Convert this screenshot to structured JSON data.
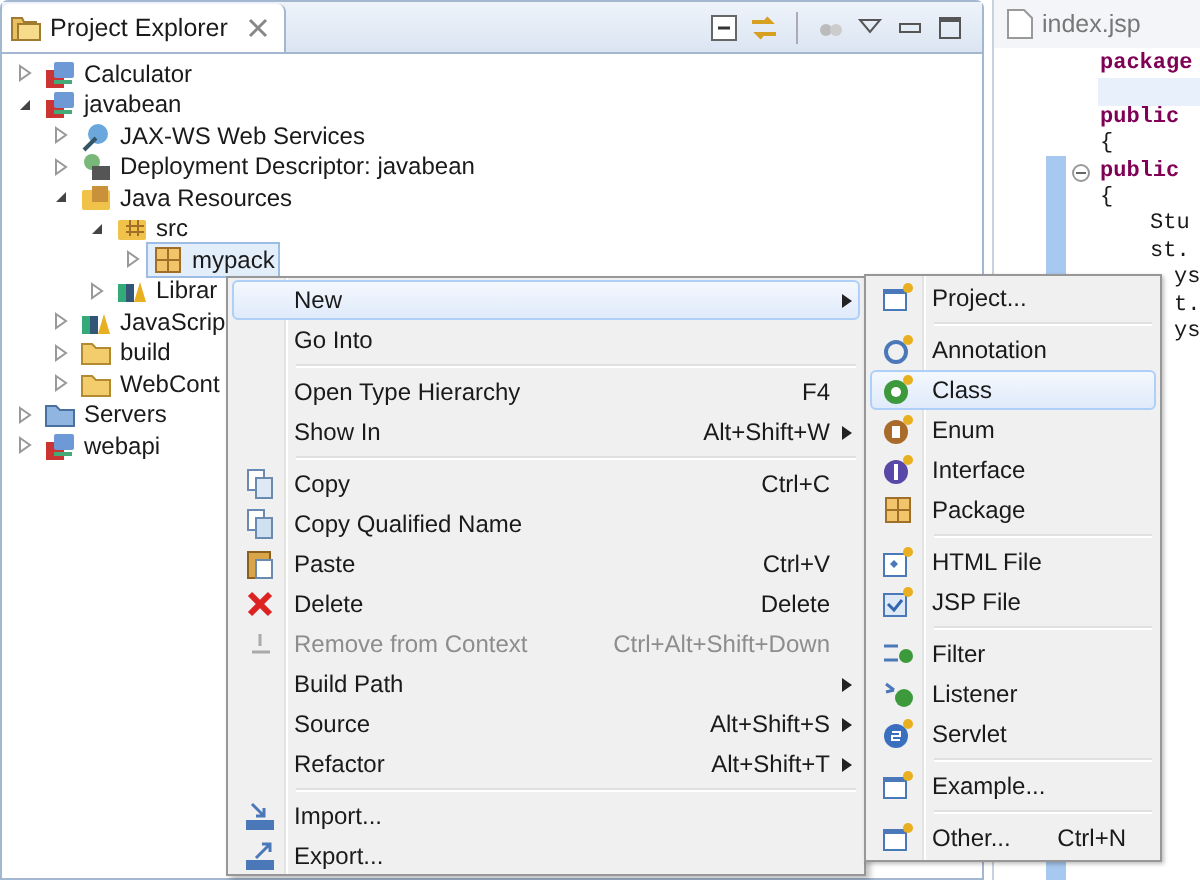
{
  "explorer": {
    "title": "Project Explorer",
    "tree": [
      {
        "label": "Calculator",
        "kind": "project",
        "expanded": false,
        "selected": false
      },
      {
        "label": "javabean",
        "kind": "project",
        "expanded": true,
        "selected": false,
        "children": [
          {
            "label": "JAX-WS Web Services",
            "kind": "webservices",
            "expanded": false,
            "selected": false
          },
          {
            "label": "Deployment Descriptor: javabean",
            "kind": "descriptor",
            "expanded": false,
            "selected": false
          },
          {
            "label": "Java Resources",
            "kind": "resources",
            "expanded": true,
            "selected": false,
            "children": [
              {
                "label": "src",
                "kind": "srcfolder",
                "expanded": true,
                "selected": false,
                "children": [
                  {
                    "label": "mypack",
                    "kind": "package",
                    "expanded": false,
                    "selected": true
                  }
                ]
              },
              {
                "label": "Librar",
                "kind": "library",
                "expanded": false,
                "selected": false
              }
            ]
          },
          {
            "label": "JavaScrip",
            "kind": "library",
            "expanded": false,
            "selected": false
          },
          {
            "label": "build",
            "kind": "folder",
            "expanded": false,
            "selected": false
          },
          {
            "label": "WebCont",
            "kind": "folder",
            "expanded": false,
            "selected": false
          }
        ]
      },
      {
        "label": "Servers",
        "kind": "servers",
        "expanded": false,
        "selected": false
      },
      {
        "label": "webapi",
        "kind": "project",
        "expanded": false,
        "selected": false
      }
    ]
  },
  "editor": {
    "tab": "index.jsp",
    "lines": [
      {
        "text": "package",
        "kind": "keyword"
      },
      {
        "kind": "current"
      },
      {
        "text": "public",
        "kind": "keyword"
      },
      {
        "text": "{",
        "kind": "plain"
      },
      {
        "text": "public",
        "kind": "keyword"
      },
      {
        "text": "{",
        "kind": "plain"
      },
      {
        "text": "Stu",
        "kind": "body"
      },
      {
        "text": "st.",
        "kind": "body"
      },
      {
        "text": "ys",
        "kind": "fragment"
      },
      {
        "text": "t.",
        "kind": "fragment"
      },
      {
        "text": "ys",
        "kind": "fragment"
      }
    ]
  },
  "context_menu": [
    {
      "label": "New",
      "kind": "plain",
      "submenu": true,
      "selected": true,
      "disabled": false
    },
    {
      "label": "Go Into",
      "kind": "plain",
      "submenu": false,
      "selected": false,
      "disabled": false
    },
    {
      "kind": "separator"
    },
    {
      "label": "Open Type Hierarchy",
      "shortcut": "F4",
      "kind": "plain",
      "submenu": false,
      "selected": false,
      "disabled": false
    },
    {
      "label": "Show In",
      "shortcut": "Alt+Shift+W",
      "kind": "plain",
      "submenu": true,
      "selected": false,
      "disabled": false
    },
    {
      "kind": "separator"
    },
    {
      "label": "Copy",
      "shortcut": "Ctrl+C",
      "kind": "copy",
      "submenu": false,
      "selected": false,
      "disabled": false
    },
    {
      "label": "Copy Qualified Name",
      "kind": "copyname",
      "submenu": false,
      "selected": false,
      "disabled": false
    },
    {
      "label": "Paste",
      "shortcut": "Ctrl+V",
      "kind": "paste",
      "submenu": false,
      "selected": false,
      "disabled": false
    },
    {
      "label": "Delete",
      "shortcut": "Delete",
      "kind": "delete",
      "submenu": false,
      "selected": false,
      "disabled": false
    },
    {
      "label": "Remove from Context",
      "shortcut": "Ctrl+Alt+Shift+Down",
      "kind": "remove",
      "submenu": false,
      "selected": false,
      "disabled": true
    },
    {
      "label": "Build Path",
      "kind": "plain",
      "submenu": true,
      "selected": false,
      "disabled": false
    },
    {
      "label": "Source",
      "shortcut": "Alt+Shift+S",
      "kind": "plain",
      "submenu": true,
      "selected": false,
      "disabled": false
    },
    {
      "label": "Refactor",
      "shortcut": "Alt+Shift+T",
      "kind": "plain",
      "submenu": true,
      "selected": false,
      "disabled": false
    },
    {
      "kind": "separator"
    },
    {
      "label": "Import...",
      "kind": "import",
      "submenu": false,
      "selected": false,
      "disabled": false
    },
    {
      "label": "Export...",
      "kind": "export",
      "submenu": false,
      "selected": false,
      "disabled": false
    }
  ],
  "new_submenu": [
    {
      "label": "Project...",
      "kind": "wizard",
      "selected": false
    },
    {
      "kind": "separator"
    },
    {
      "label": "Annotation",
      "kind": "annotation",
      "selected": false
    },
    {
      "label": "Class",
      "kind": "class",
      "selected": true
    },
    {
      "label": "Enum",
      "kind": "enum",
      "selected": false
    },
    {
      "label": "Interface",
      "kind": "interface",
      "selected": false
    },
    {
      "label": "Package",
      "kind": "package",
      "selected": false
    },
    {
      "kind": "separator"
    },
    {
      "label": "HTML File",
      "kind": "html",
      "selected": false
    },
    {
      "label": "JSP File",
      "kind": "jsp",
      "selected": false
    },
    {
      "kind": "separator"
    },
    {
      "label": "Filter",
      "kind": "filter",
      "selected": false
    },
    {
      "label": "Listener",
      "kind": "listener",
      "selected": false
    },
    {
      "label": "Servlet",
      "kind": "servlet",
      "selected": false
    },
    {
      "kind": "separator"
    },
    {
      "label": "Example...",
      "kind": "wizard",
      "selected": false
    },
    {
      "kind": "separator"
    },
    {
      "label": "Other...",
      "shortcut": "Ctrl+N",
      "kind": "wizard",
      "selected": false
    }
  ]
}
